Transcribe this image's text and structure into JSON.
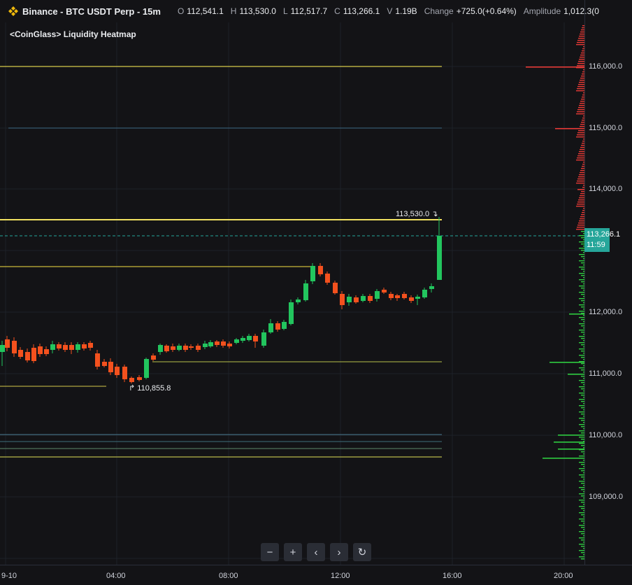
{
  "header": {
    "symbol": "Binance - BTC USDT Perp - 15m",
    "o_label": "O",
    "o_value": "112,541.1",
    "h_label": "H",
    "h_value": "113,530.0",
    "l_label": "L",
    "l_value": "112,517.7",
    "c_label": "C",
    "c_value": "113,266.1",
    "v_label": "V",
    "v_value": "1.19B",
    "change_label": "Change",
    "change_value": "+725.0(+0.64%)",
    "amplitude_label": "Amplitude",
    "amplitude_value": "1,012.3(0"
  },
  "indicator": {
    "title": "<CoinGlass> Liquidity Heatmap"
  },
  "price_axis": {
    "labels": [
      "116,000.0",
      "115,000.0",
      "114,000.0",
      "112,000.0",
      "111,000.0",
      "110,000.0",
      "109,000.0"
    ],
    "last_price": "113,266.1",
    "countdown": "11:59"
  },
  "time_axis": {
    "labels": [
      "9-10",
      "04:00",
      "08:00",
      "12:00",
      "16:00",
      "20:00"
    ]
  },
  "markers": {
    "high": "113,530.0",
    "low": "110,855.8"
  },
  "controls": {
    "zoom_out": "−",
    "zoom_in": "+",
    "left": "‹",
    "right": "›",
    "reset": "↻"
  },
  "colors": {
    "up": "#22c55e",
    "down": "#f4511e",
    "accent": "#26a69a",
    "level": "#e6d54a"
  }
}
